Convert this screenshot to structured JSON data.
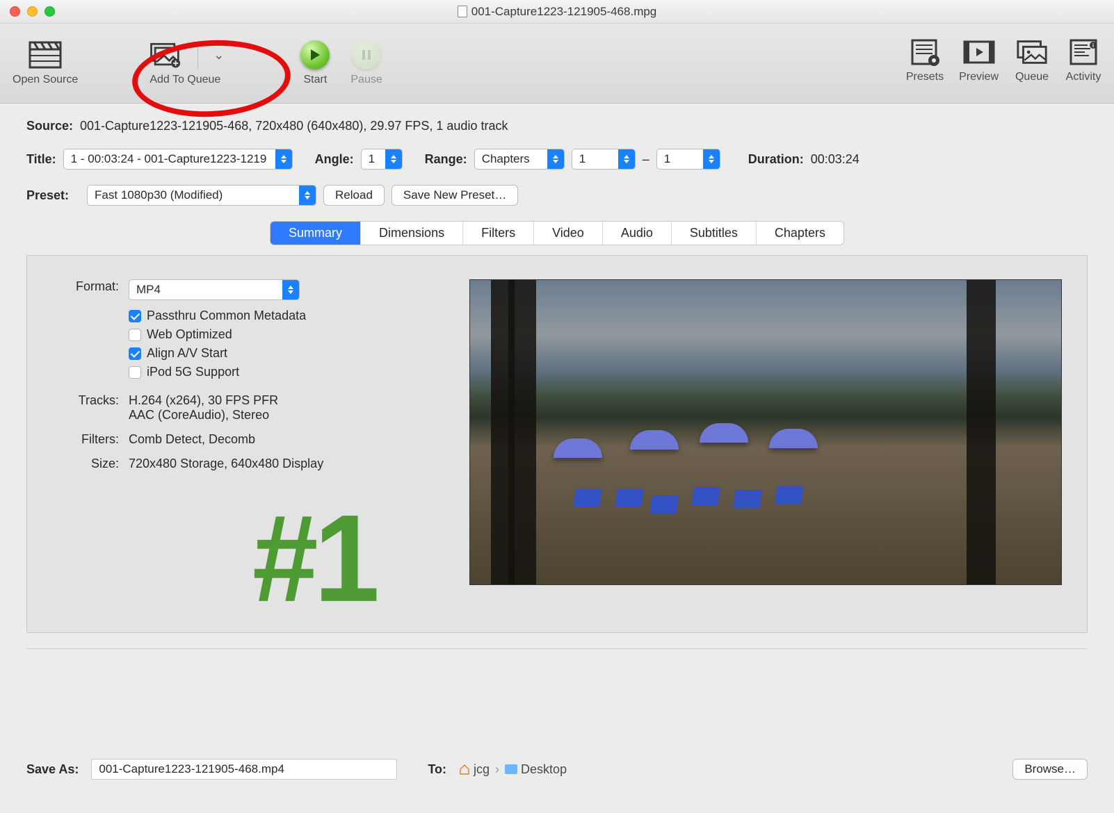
{
  "window": {
    "title": "001-Capture1223-121905-468.mpg"
  },
  "toolbar": {
    "open_source": "Open Source",
    "add_to_queue": "Add To Queue",
    "start": "Start",
    "pause": "Pause",
    "presets": "Presets",
    "preview": "Preview",
    "queue": "Queue",
    "activity": "Activity"
  },
  "source": {
    "label": "Source:",
    "value": "001-Capture1223-121905-468, 720x480 (640x480), 29.97 FPS, 1 audio track"
  },
  "title_row": {
    "label": "Title:",
    "value": "1 - 00:03:24 - 001-Capture1223-1219",
    "angle_label": "Angle:",
    "angle_value": "1",
    "range_label": "Range:",
    "range_type": "Chapters",
    "range_from": "1",
    "range_dash": "–",
    "range_to": "1",
    "duration_label": "Duration:",
    "duration_value": "00:03:24"
  },
  "preset_row": {
    "label": "Preset:",
    "value": "Fast 1080p30 (Modified)",
    "reload": "Reload",
    "save_new": "Save New Preset…"
  },
  "tabs": [
    "Summary",
    "Dimensions",
    "Filters",
    "Video",
    "Audio",
    "Subtitles",
    "Chapters"
  ],
  "summary": {
    "format_label": "Format:",
    "format_value": "MP4",
    "passthru": "Passthru Common Metadata",
    "web_optimized": "Web Optimized",
    "align_av": "Align A/V Start",
    "ipod": "iPod 5G Support",
    "tracks_label": "Tracks:",
    "tracks_value1": "H.264 (x264), 30 FPS PFR",
    "tracks_value2": "AAC (CoreAudio), Stereo",
    "filters_label": "Filters:",
    "filters_value": "Comb Detect, Decomb",
    "size_label": "Size:",
    "size_value": "720x480 Storage, 640x480 Display"
  },
  "annotation": "#1",
  "footer": {
    "save_as_label": "Save As:",
    "save_as_value": "001-Capture1223-121905-468.mp4",
    "to_label": "To:",
    "path_user": "jcg",
    "path_folder": "Desktop",
    "browse": "Browse…"
  }
}
